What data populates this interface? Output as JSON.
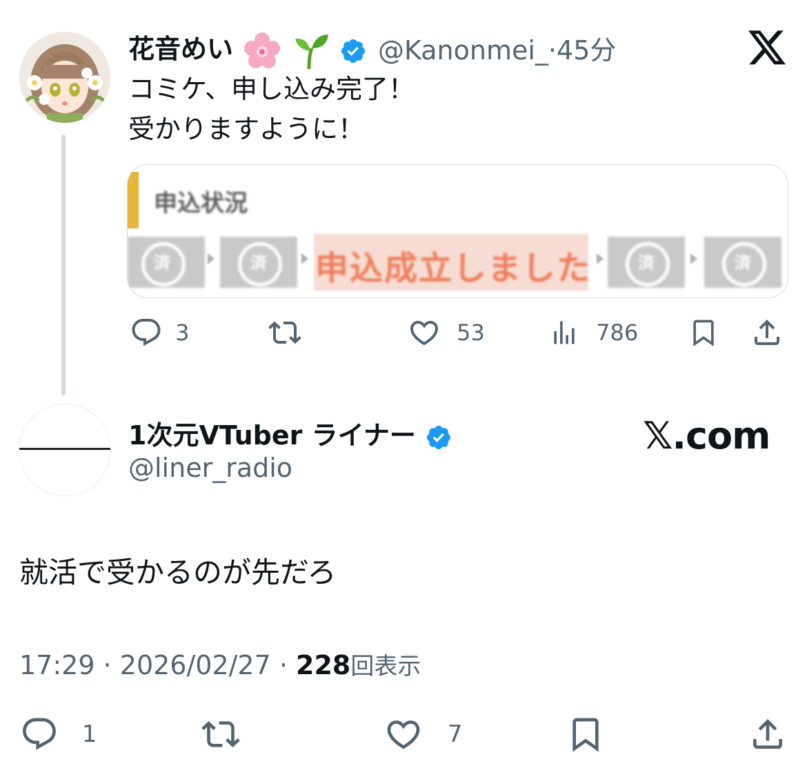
{
  "parent_tweet": {
    "display_name": "花音めい",
    "name_emojis": [
      "cherry-blossom",
      "seedling"
    ],
    "verified": true,
    "handle": "@Kanonmei_",
    "separator": "·",
    "time_ago": "45分",
    "text_lines": [
      "コミケ、申し込み完了！",
      "受かりますように！"
    ],
    "card": {
      "title": "申込状況",
      "status": "申込成立しました",
      "step_label": "済"
    },
    "actions": {
      "replies": "3",
      "retweets": "",
      "likes": "53",
      "views": "786"
    }
  },
  "reply_tweet": {
    "display_name": "1次元VTuber ライナー",
    "verified": true,
    "handle": "@liner_radio",
    "brand": "𝕏.com",
    "text": "就活で受かるのが先だろ",
    "time": "17:29",
    "date": "2026/02/27",
    "views_count": "228",
    "views_label": "回表示",
    "meta_sep": " · ",
    "actions": {
      "replies": "1",
      "retweets": "",
      "likes": "7"
    }
  },
  "colors": {
    "verified_badge": "#1d9bf0",
    "secondary_text": "#536471",
    "card_accent": "#e8b73a",
    "status_text": "#ef7d5a"
  }
}
